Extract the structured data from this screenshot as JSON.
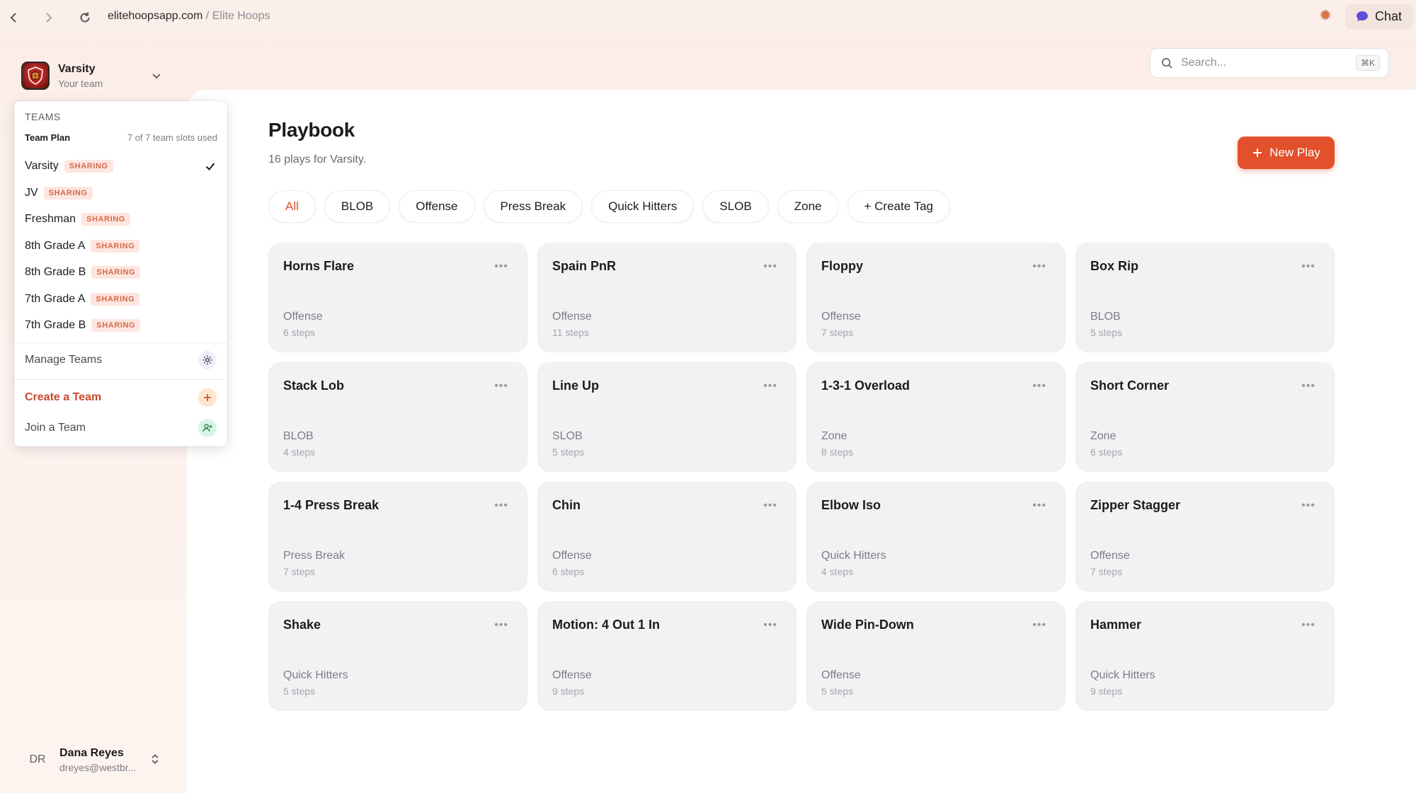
{
  "browser": {
    "url_host": "elitehoopsapp.com",
    "url_separator": " / ",
    "url_site": "Elite Hoops",
    "chat_label": "Chat"
  },
  "team_switcher": {
    "name": "Varsity",
    "subtitle": "Your team"
  },
  "dropdown": {
    "heading": "TEAMS",
    "plan": "Team Plan",
    "slots": "7 of 7 team slots used",
    "teams": [
      {
        "name": "Varsity",
        "badge": "SHARING",
        "selected": true
      },
      {
        "name": "JV",
        "badge": "SHARING",
        "selected": false
      },
      {
        "name": "Freshman",
        "badge": "SHARING",
        "selected": false
      },
      {
        "name": "8th Grade A",
        "badge": "SHARING",
        "selected": false
      },
      {
        "name": "8th Grade B",
        "badge": "SHARING",
        "selected": false
      },
      {
        "name": "7th Grade A",
        "badge": "SHARING",
        "selected": false
      },
      {
        "name": "7th Grade B",
        "badge": "SHARING",
        "selected": false
      }
    ],
    "manage": "Manage Teams",
    "create": "Create a Team",
    "join": "Join a Team"
  },
  "user": {
    "initials": "DR",
    "name": "Dana Reyes",
    "email": "dreyes@westbr..."
  },
  "search": {
    "placeholder": "Search...",
    "shortcut": "⌘K"
  },
  "page": {
    "title": "Playbook",
    "subtitle": "16 plays for Varsity.",
    "new_play": "New Play"
  },
  "tags": [
    "All",
    "BLOB",
    "Offense",
    "Press Break",
    "Quick Hitters",
    "SLOB",
    "Zone",
    "+ Create Tag"
  ],
  "plays": [
    {
      "title": "Horns Flare",
      "tag": "Offense",
      "steps": "6 steps"
    },
    {
      "title": "Spain PnR",
      "tag": "Offense",
      "steps": "11 steps"
    },
    {
      "title": "Floppy",
      "tag": "Offense",
      "steps": "7 steps"
    },
    {
      "title": "Box Rip",
      "tag": "BLOB",
      "steps": "5 steps"
    },
    {
      "title": "Stack Lob",
      "tag": "BLOB",
      "steps": "4 steps"
    },
    {
      "title": "Line Up",
      "tag": "SLOB",
      "steps": "5 steps"
    },
    {
      "title": "1-3-1 Overload",
      "tag": "Zone",
      "steps": "8 steps"
    },
    {
      "title": "Short Corner",
      "tag": "Zone",
      "steps": "6 steps"
    },
    {
      "title": "1-4 Press Break",
      "tag": "Press Break",
      "steps": "7 steps"
    },
    {
      "title": "Chin",
      "tag": "Offense",
      "steps": "6 steps"
    },
    {
      "title": "Elbow Iso",
      "tag": "Quick Hitters",
      "steps": "4 steps"
    },
    {
      "title": "Zipper Stagger",
      "tag": "Offense",
      "steps": "7 steps"
    },
    {
      "title": "Shake",
      "tag": "Quick Hitters",
      "steps": "5 steps"
    },
    {
      "title": "Motion: 4 Out 1 In",
      "tag": "Offense",
      "steps": "9 steps"
    },
    {
      "title": "Wide Pin-Down",
      "tag": "Offense",
      "steps": "5 steps"
    },
    {
      "title": "Hammer",
      "tag": "Quick Hitters",
      "steps": "9 steps"
    }
  ],
  "colors": {
    "accent": "#e2502c",
    "badge_text": "#d5694b",
    "badge_bg": "#fde6df",
    "card_bg": "#f2f2f5"
  },
  "icons": {
    "back": "chevron-left-icon",
    "forward": "chevron-right-icon",
    "reload": "reload-icon",
    "extension": "sparkle-icon",
    "chat": "chat-bubble-icon",
    "search": "search-icon",
    "more": "more-horizontal-icon",
    "check": "check-icon",
    "settings": "gear-icon",
    "add": "plus-icon",
    "join": "user-plus-icon"
  }
}
